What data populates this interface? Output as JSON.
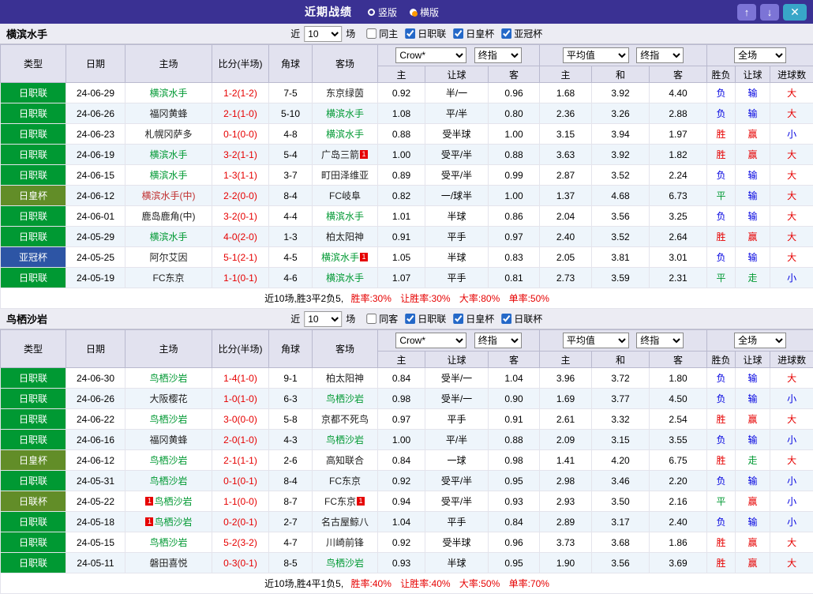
{
  "titlebar": {
    "title": "近期战绩",
    "layout_options": [
      {
        "label": "竖版",
        "selected": false
      },
      {
        "label": "横版",
        "selected": true
      }
    ],
    "up_icon": "↑",
    "down_icon": "↓",
    "close_icon": "✕"
  },
  "tables": [
    {
      "team": "横滨水手",
      "filter": {
        "near_label": "近",
        "games": "10",
        "games_label": "场",
        "checkboxes": [
          {
            "label": "同主",
            "checked": false
          },
          {
            "label": "日职联",
            "checked": true
          },
          {
            "label": "日皇杯",
            "checked": true
          },
          {
            "label": "亚冠杯",
            "checked": true
          }
        ]
      },
      "header": {
        "cols": [
          "类型",
          "日期",
          "主场",
          "比分(半场)",
          "角球",
          "客场"
        ],
        "groups": [
          {
            "selects": [
              "Crow*",
              "终指"
            ],
            "subs": [
              "主",
              "让球",
              "客"
            ]
          },
          {
            "selects": [
              "平均值",
              "终指"
            ],
            "subs": [
              "主",
              "和",
              "客"
            ]
          },
          {
            "selects": [
              "全场"
            ],
            "subs": [
              "胜负",
              "让球",
              "进球数"
            ]
          }
        ]
      },
      "rows": [
        {
          "league": "日职联",
          "lg": "green",
          "date": "24-06-29",
          "home": {
            "text": "横滨水手",
            "cls": "g"
          },
          "score": "1-2(1-2)",
          "corner": "7-5",
          "away": {
            "text": "东京绿茵",
            "cls": "k"
          },
          "odds": [
            "0.92",
            "半/一",
            "0.96",
            "1.68",
            "3.92",
            "4.40"
          ],
          "res": [
            [
              "负",
              "blue"
            ],
            [
              "输",
              "blue"
            ],
            [
              "大",
              "red"
            ]
          ]
        },
        {
          "league": "日职联",
          "lg": "green",
          "date": "24-06-26",
          "home": {
            "text": "福冈黄蜂",
            "cls": "k"
          },
          "score": "2-1(1-0)",
          "corner": "5-10",
          "away": {
            "text": "横滨水手",
            "cls": "g"
          },
          "odds": [
            "1.08",
            "平/半",
            "0.80",
            "2.36",
            "3.26",
            "2.88"
          ],
          "res": [
            [
              "负",
              "blue"
            ],
            [
              "输",
              "blue"
            ],
            [
              "大",
              "red"
            ]
          ]
        },
        {
          "league": "日职联",
          "lg": "green",
          "date": "24-06-23",
          "home": {
            "text": "札幌冈萨多",
            "cls": "k"
          },
          "score": "0-1(0-0)",
          "corner": "4-8",
          "away": {
            "text": "横滨水手",
            "cls": "g"
          },
          "odds": [
            "0.88",
            "受半球",
            "1.00",
            "3.15",
            "3.94",
            "1.97"
          ],
          "res": [
            [
              "胜",
              "red"
            ],
            [
              "赢",
              "red"
            ],
            [
              "小",
              "blue"
            ]
          ]
        },
        {
          "league": "日职联",
          "lg": "green",
          "date": "24-06-19",
          "home": {
            "text": "横滨水手",
            "cls": "g"
          },
          "score": "3-2(1-1)",
          "corner": "5-4",
          "away": {
            "text": "广岛三箭",
            "cls": "k",
            "badge_post": "1"
          },
          "odds": [
            "1.00",
            "受平/半",
            "0.88",
            "3.63",
            "3.92",
            "1.82"
          ],
          "res": [
            [
              "胜",
              "red"
            ],
            [
              "赢",
              "red"
            ],
            [
              "大",
              "red"
            ]
          ]
        },
        {
          "league": "日职联",
          "lg": "green",
          "date": "24-06-15",
          "home": {
            "text": "横滨水手",
            "cls": "g"
          },
          "score": "1-3(1-1)",
          "corner": "3-7",
          "away": {
            "text": "町田泽维亚",
            "cls": "k"
          },
          "odds": [
            "0.89",
            "受平/半",
            "0.99",
            "2.87",
            "3.52",
            "2.24"
          ],
          "res": [
            [
              "负",
              "blue"
            ],
            [
              "输",
              "blue"
            ],
            [
              "大",
              "red"
            ]
          ]
        },
        {
          "league": "日皇杯",
          "lg": "olive",
          "date": "24-06-12",
          "home": {
            "text": "横滨水手(中)",
            "cls": "r"
          },
          "score": "2-2(0-0)",
          "corner": "8-4",
          "away": {
            "text": "FC岐阜",
            "cls": "k"
          },
          "odds": [
            "0.82",
            "一/球半",
            "1.00",
            "1.37",
            "4.68",
            "6.73"
          ],
          "res": [
            [
              "平",
              "green"
            ],
            [
              "输",
              "blue"
            ],
            [
              "大",
              "red"
            ]
          ]
        },
        {
          "league": "日职联",
          "lg": "green",
          "date": "24-06-01",
          "home": {
            "text": "鹿岛鹿角(中)",
            "cls": "k"
          },
          "score": "3-2(0-1)",
          "corner": "4-4",
          "away": {
            "text": "横滨水手",
            "cls": "g"
          },
          "odds": [
            "1.01",
            "半球",
            "0.86",
            "2.04",
            "3.56",
            "3.25"
          ],
          "res": [
            [
              "负",
              "blue"
            ],
            [
              "输",
              "blue"
            ],
            [
              "大",
              "red"
            ]
          ]
        },
        {
          "league": "日职联",
          "lg": "green",
          "date": "24-05-29",
          "home": {
            "text": "横滨水手",
            "cls": "g"
          },
          "score": "4-0(2-0)",
          "corner": "1-3",
          "away": {
            "text": "柏太阳神",
            "cls": "k"
          },
          "odds": [
            "0.91",
            "平手",
            "0.97",
            "2.40",
            "3.52",
            "2.64"
          ],
          "res": [
            [
              "胜",
              "red"
            ],
            [
              "赢",
              "red"
            ],
            [
              "大",
              "red"
            ]
          ]
        },
        {
          "league": "亚冠杯",
          "lg": "blue",
          "date": "24-05-25",
          "home": {
            "text": "阿尔艾因",
            "cls": "k"
          },
          "score": "5-1(2-1)",
          "corner": "4-5",
          "away": {
            "text": "横滨水手",
            "cls": "g",
            "badge_post": "1"
          },
          "odds": [
            "1.05",
            "半球",
            "0.83",
            "2.05",
            "3.81",
            "3.01"
          ],
          "res": [
            [
              "负",
              "blue"
            ],
            [
              "输",
              "blue"
            ],
            [
              "大",
              "red"
            ]
          ]
        },
        {
          "league": "日职联",
          "lg": "green",
          "date": "24-05-19",
          "home": {
            "text": "FC东京",
            "cls": "k"
          },
          "score": "1-1(0-1)",
          "corner": "4-6",
          "away": {
            "text": "横滨水手",
            "cls": "g"
          },
          "odds": [
            "1.07",
            "平手",
            "0.81",
            "2.73",
            "3.59",
            "2.31"
          ],
          "res": [
            [
              "平",
              "green"
            ],
            [
              "走",
              "green"
            ],
            [
              "小",
              "blue"
            ]
          ]
        }
      ],
      "summary_prefix": "近10场,胜3平2负5,",
      "summary_stats": "胜率:30% 让胜率:30% 大率:80% 单率:50%"
    },
    {
      "team": "鸟栖沙岩",
      "filter": {
        "near_label": "近",
        "games": "10",
        "games_label": "场",
        "checkboxes": [
          {
            "label": "同客",
            "checked": false
          },
          {
            "label": "日职联",
            "checked": true
          },
          {
            "label": "日皇杯",
            "checked": true
          },
          {
            "label": "日联杯",
            "checked": true
          }
        ]
      },
      "header": {
        "cols": [
          "类型",
          "日期",
          "主场",
          "比分(半场)",
          "角球",
          "客场"
        ],
        "groups": [
          {
            "selects": [
              "Crow*",
              "终指"
            ],
            "subs": [
              "主",
              "让球",
              "客"
            ]
          },
          {
            "selects": [
              "平均值",
              "终指"
            ],
            "subs": [
              "主",
              "和",
              "客"
            ]
          },
          {
            "selects": [
              "全场"
            ],
            "subs": [
              "胜负",
              "让球",
              "进球数"
            ]
          }
        ]
      },
      "rows": [
        {
          "league": "日职联",
          "lg": "green",
          "date": "24-06-30",
          "home": {
            "text": "鸟栖沙岩",
            "cls": "g"
          },
          "score": "1-4(1-0)",
          "corner": "9-1",
          "away": {
            "text": "柏太阳神",
            "cls": "k"
          },
          "odds": [
            "0.84",
            "受半/一",
            "1.04",
            "3.96",
            "3.72",
            "1.80"
          ],
          "res": [
            [
              "负",
              "blue"
            ],
            [
              "输",
              "blue"
            ],
            [
              "大",
              "red"
            ]
          ]
        },
        {
          "league": "日职联",
          "lg": "green",
          "date": "24-06-26",
          "home": {
            "text": "大阪樱花",
            "cls": "k"
          },
          "score": "1-0(1-0)",
          "corner": "6-3",
          "away": {
            "text": "鸟栖沙岩",
            "cls": "g"
          },
          "odds": [
            "0.98",
            "受半/一",
            "0.90",
            "1.69",
            "3.77",
            "4.50"
          ],
          "res": [
            [
              "负",
              "blue"
            ],
            [
              "输",
              "blue"
            ],
            [
              "小",
              "blue"
            ]
          ]
        },
        {
          "league": "日职联",
          "lg": "green",
          "date": "24-06-22",
          "home": {
            "text": "鸟栖沙岩",
            "cls": "g"
          },
          "score": "3-0(0-0)",
          "corner": "5-8",
          "away": {
            "text": "京都不死鸟",
            "cls": "k"
          },
          "odds": [
            "0.97",
            "平手",
            "0.91",
            "2.61",
            "3.32",
            "2.54"
          ],
          "res": [
            [
              "胜",
              "red"
            ],
            [
              "赢",
              "red"
            ],
            [
              "大",
              "red"
            ]
          ]
        },
        {
          "league": "日职联",
          "lg": "green",
          "date": "24-06-16",
          "home": {
            "text": "福冈黄蜂",
            "cls": "k"
          },
          "score": "2-0(1-0)",
          "corner": "4-3",
          "away": {
            "text": "鸟栖沙岩",
            "cls": "g"
          },
          "odds": [
            "1.00",
            "平/半",
            "0.88",
            "2.09",
            "3.15",
            "3.55"
          ],
          "res": [
            [
              "负",
              "blue"
            ],
            [
              "输",
              "blue"
            ],
            [
              "小",
              "blue"
            ]
          ]
        },
        {
          "league": "日皇杯",
          "lg": "olive",
          "date": "24-06-12",
          "home": {
            "text": "鸟栖沙岩",
            "cls": "g"
          },
          "score": "2-1(1-1)",
          "corner": "2-6",
          "away": {
            "text": "高知联合",
            "cls": "k"
          },
          "odds": [
            "0.84",
            "一球",
            "0.98",
            "1.41",
            "4.20",
            "6.75"
          ],
          "res": [
            [
              "胜",
              "red"
            ],
            [
              "走",
              "green"
            ],
            [
              "大",
              "red"
            ]
          ]
        },
        {
          "league": "日职联",
          "lg": "green",
          "date": "24-05-31",
          "home": {
            "text": "鸟栖沙岩",
            "cls": "g"
          },
          "score": "0-1(0-1)",
          "corner": "8-4",
          "away": {
            "text": "FC东京",
            "cls": "k"
          },
          "odds": [
            "0.92",
            "受平/半",
            "0.95",
            "2.98",
            "3.46",
            "2.20"
          ],
          "res": [
            [
              "负",
              "blue"
            ],
            [
              "输",
              "blue"
            ],
            [
              "小",
              "blue"
            ]
          ]
        },
        {
          "league": "日联杯",
          "lg": "olive",
          "date": "24-05-22",
          "home": {
            "text": "鸟栖沙岩",
            "cls": "g",
            "badge_pre": "1"
          },
          "score": "1-1(0-0)",
          "corner": "8-7",
          "away": {
            "text": "FC东京",
            "cls": "k",
            "badge_post": "1"
          },
          "odds": [
            "0.94",
            "受平/半",
            "0.93",
            "2.93",
            "3.50",
            "2.16"
          ],
          "res": [
            [
              "平",
              "green"
            ],
            [
              "赢",
              "red"
            ],
            [
              "小",
              "blue"
            ]
          ]
        },
        {
          "league": "日职联",
          "lg": "green",
          "date": "24-05-18",
          "home": {
            "text": "鸟栖沙岩",
            "cls": "g",
            "badge_pre": "1"
          },
          "score": "0-2(0-1)",
          "corner": "2-7",
          "away": {
            "text": "名古屋鲸八",
            "cls": "k"
          },
          "odds": [
            "1.04",
            "平手",
            "0.84",
            "2.89",
            "3.17",
            "2.40"
          ],
          "res": [
            [
              "负",
              "blue"
            ],
            [
              "输",
              "blue"
            ],
            [
              "小",
              "blue"
            ]
          ]
        },
        {
          "league": "日职联",
          "lg": "green",
          "date": "24-05-15",
          "home": {
            "text": "鸟栖沙岩",
            "cls": "g"
          },
          "score": "5-2(3-2)",
          "corner": "4-7",
          "away": {
            "text": "川崎前锋",
            "cls": "k"
          },
          "odds": [
            "0.92",
            "受半球",
            "0.96",
            "3.73",
            "3.68",
            "1.86"
          ],
          "res": [
            [
              "胜",
              "red"
            ],
            [
              "赢",
              "red"
            ],
            [
              "大",
              "red"
            ]
          ]
        },
        {
          "league": "日职联",
          "lg": "green",
          "date": "24-05-11",
          "home": {
            "text": "磐田喜悦",
            "cls": "k"
          },
          "score": "0-3(0-1)",
          "corner": "8-5",
          "away": {
            "text": "鸟栖沙岩",
            "cls": "g"
          },
          "odds": [
            "0.93",
            "半球",
            "0.95",
            "1.90",
            "3.56",
            "3.69"
          ],
          "res": [
            [
              "胜",
              "red"
            ],
            [
              "赢",
              "red"
            ],
            [
              "大",
              "red"
            ]
          ]
        }
      ],
      "summary_prefix": "近10场,胜4平1负5,",
      "summary_stats": "胜率:40% 让胜率:40% 大率:50% 单率:70%"
    }
  ]
}
